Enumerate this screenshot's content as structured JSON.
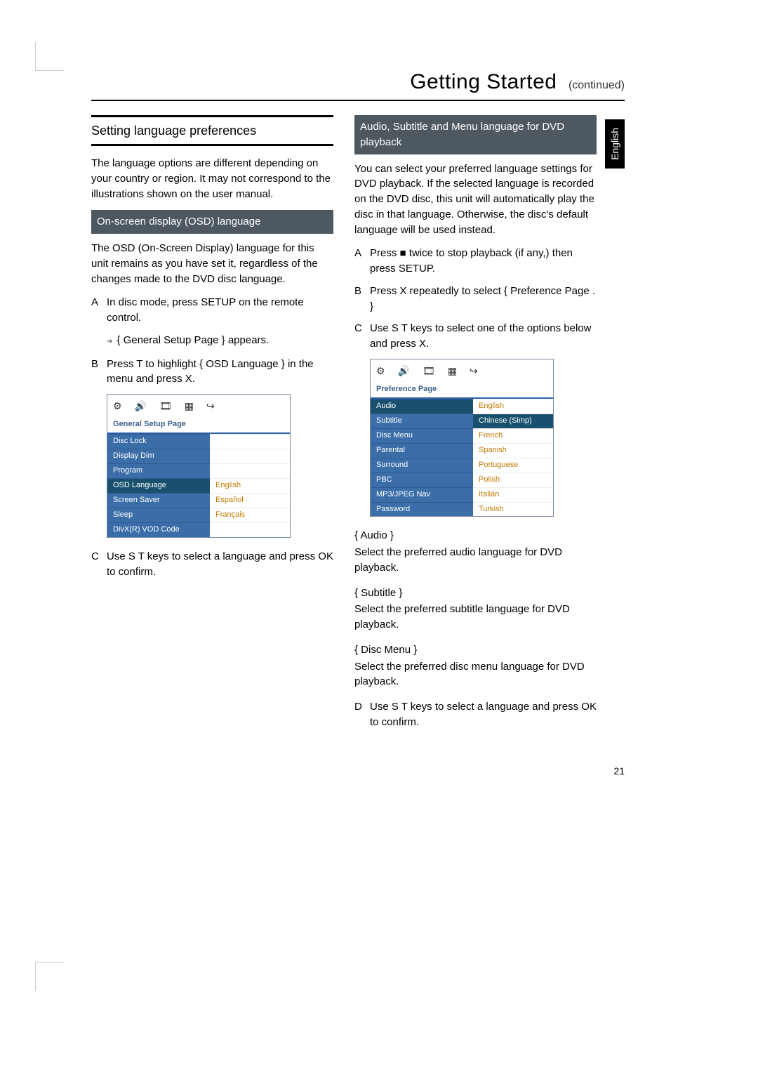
{
  "language_tab": "English",
  "header": {
    "main": "Getting Started",
    "sub": "(continued)"
  },
  "section_title": "Setting language preferences",
  "page_number": "21",
  "left": {
    "intro": "The language options are different depending on your country or region. It may not correspond to the illustrations shown on the user manual.",
    "subbar": "On-screen display (OSD) language",
    "desc": "The OSD (On-Screen Display) language for this unit remains as you have set it, regardless of the changes made to the DVD disc language.",
    "stepA": "In disc mode, press SETUP on the remote control.",
    "stepA_arrow": "{ General Setup Page } appears.",
    "stepB": "Press T to highlight { OSD Language } in the menu and press X.",
    "stepC": "Use S T keys to select a language and press OK to conﬁrm.",
    "menu": {
      "title": "General Setup Page",
      "left_items": [
        "Disc Lock",
        "Display Dim",
        "Program",
        "OSD Language",
        "Screen Saver",
        "Sleep",
        "DivX(R) VOD Code"
      ],
      "right_items": [
        "",
        "",
        "",
        "English",
        "Español",
        "Français",
        ""
      ],
      "highlight_index": 3
    }
  },
  "right": {
    "subbar": "Audio, Subtitle and Menu language for DVD playback",
    "desc": "You can select your preferred language settings for DVD playback.  If the selected language is recorded on the DVD disc, this unit will automatically play the disc in that language.  Otherwise, the disc's default language will be used instead.",
    "stepA": "Press ■ twice to stop playback (if any,) then press SETUP.",
    "stepB": "Press X repeatedly to select { Preference Page . }",
    "stepC": "Use S T keys to select one of the options below and press X.",
    "menu": {
      "title": "Preference Page",
      "left_items": [
        "Audio",
        "Subtitle",
        "Disc Menu",
        "Parental",
        "Surround",
        "PBC",
        "MP3/JPEG Nav",
        "Password"
      ],
      "right_items": [
        "English",
        "Chinese (Simp)",
        "French",
        "Spanish",
        "Portuguese",
        "Polish",
        "Italian",
        "Turkish"
      ],
      "highlight_index": 0,
      "right_highlight_index": 1,
      "show_down": true
    },
    "braces": [
      {
        "name": "{ Audio }",
        "desc": "Select the preferred audio language for DVD playback."
      },
      {
        "name": "{ Subtitle }",
        "desc": "Select the preferred subtitle language for DVD playback."
      },
      {
        "name": "{ Disc Menu }",
        "desc": "Select the preferred disc menu language for DVD playback."
      }
    ],
    "stepD": "Use S T keys to select a language and press OK to conﬁrm."
  },
  "icons": [
    "⚙",
    "🔊",
    "🎞",
    "▦",
    "↪"
  ]
}
